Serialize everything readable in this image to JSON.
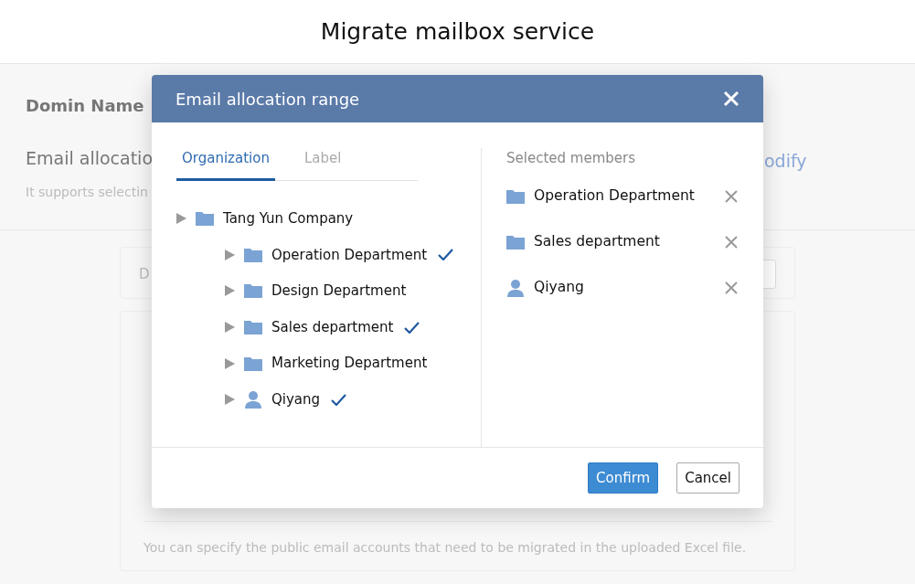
{
  "page": {
    "title": "Migrate mailbox service",
    "domain_label": "Domin Name",
    "allocation_label": "Email allocatio",
    "allocation_hint": "It supports selectin",
    "modify_link": "odify",
    "card_label": "D",
    "note": "You can specify the public email accounts that need to be migrated in the uploaded Excel file."
  },
  "dialog": {
    "title": "Email allocation range",
    "tabs": [
      {
        "label": "Organization",
        "selected": true
      },
      {
        "label": "Label",
        "selected": false
      }
    ],
    "tree": [
      {
        "label": "Tang Yun Company",
        "kind": "folder",
        "checked": false,
        "children": [
          {
            "label": "Operation Department",
            "kind": "folder",
            "checked": true
          },
          {
            "label": "Design Department",
            "kind": "folder",
            "checked": false
          },
          {
            "label": "Sales department",
            "kind": "folder",
            "checked": true
          },
          {
            "label": "Marketing Department",
            "kind": "folder",
            "checked": false
          },
          {
            "label": "Qiyang",
            "kind": "person",
            "checked": true
          }
        ]
      }
    ],
    "selected_heading": "Selected members",
    "selected_members": [
      {
        "label": "Operation Department",
        "kind": "folder"
      },
      {
        "label": "Sales department",
        "kind": "folder"
      },
      {
        "label": "Qiyang",
        "kind": "person"
      }
    ],
    "buttons": [
      {
        "label": "Confirm",
        "kind": "primary"
      },
      {
        "label": "Cancel",
        "kind": "secondary"
      }
    ]
  }
}
